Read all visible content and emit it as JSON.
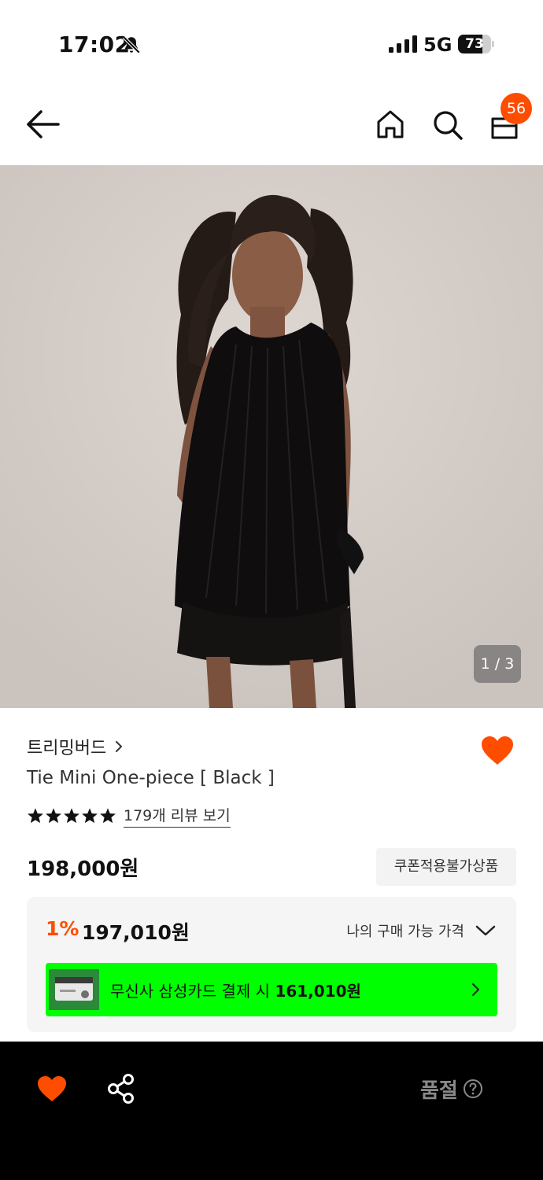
{
  "status_bar": {
    "time": "17:02",
    "network": "5G",
    "battery": "73",
    "battery_level": 0.73,
    "icons": [
      "bell-off-icon",
      "signal-icon",
      "battery-icon"
    ]
  },
  "nav": {
    "icons": [
      "back-arrow-icon",
      "home-icon",
      "search-icon",
      "cart-icon"
    ],
    "cart_count": "56"
  },
  "gallery": {
    "counter": "1 / 3"
  },
  "product": {
    "brand": "트리밍버드",
    "name": "Tie Mini One-piece [ Black ]",
    "rating_stars": 5,
    "review_link": "179개 리뷰 보기",
    "price": "198,000원",
    "coupon_notice": "쿠폰적용불가상품",
    "liked": true
  },
  "price_box": {
    "discount_rate": "1%",
    "discount_price": "197,010원",
    "my_price_label": "나의 구매 가능 가격",
    "card_promo_prefix": "무신사 삼성카드 결제 시 ",
    "card_promo_price": "161,010원"
  },
  "bottom_bar": {
    "status": "품절",
    "icons": [
      "heart-icon",
      "share-icon",
      "help-circle-icon"
    ]
  },
  "colors": {
    "accent": "#ff4d00",
    "promo_green": "#00ff00",
    "bottom_bar": "#000000"
  }
}
